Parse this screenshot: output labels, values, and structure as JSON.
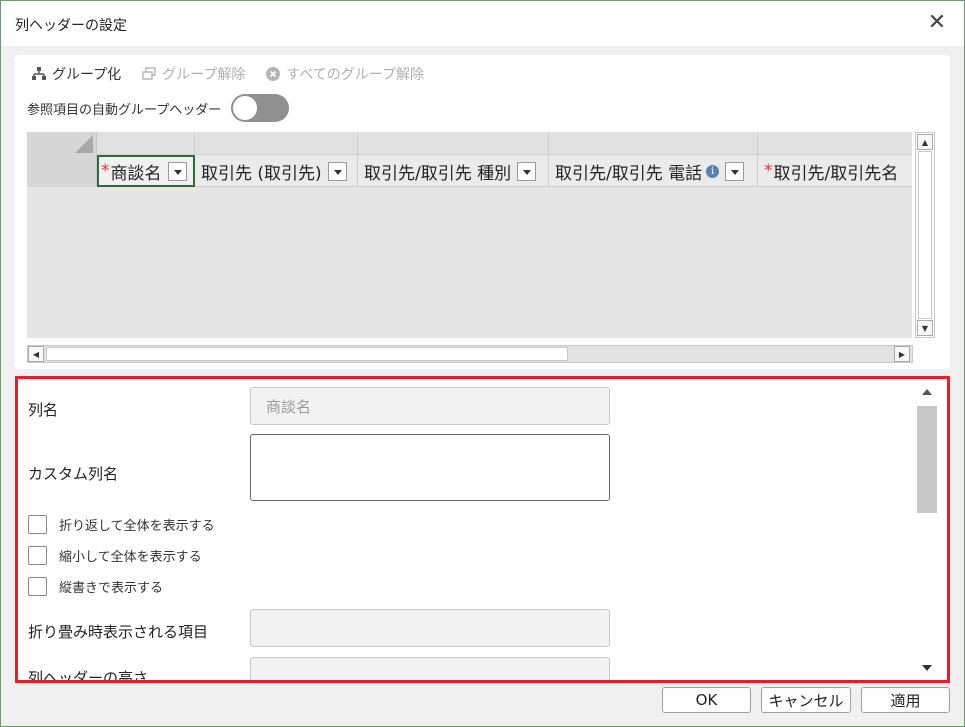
{
  "dialog": {
    "title": "列ヘッダーの設定",
    "close_glyph": "✕"
  },
  "toolbar": {
    "group": "グループ化",
    "ungroup": "グループ解除",
    "ungroup_all": "すべてのグループ解除"
  },
  "auto_group_toggle": {
    "label": "参照項目の自動グループヘッダー",
    "on": false
  },
  "grid": {
    "columns": [
      {
        "label": "商談名",
        "required": true,
        "selected": true
      },
      {
        "label": "取引先 (取引先)",
        "required": false
      },
      {
        "label": "取引先/取引先 種別",
        "required": false
      },
      {
        "label": "取引先/取引先 電話",
        "required": false,
        "info": "i"
      },
      {
        "label": "取引先/取引先名",
        "required": true
      }
    ],
    "required_mark": "*"
  },
  "properties": {
    "column_name": {
      "label": "列名",
      "placeholder": "商談名"
    },
    "custom_column_name": {
      "label": "カスタム列名",
      "value": ""
    },
    "checkboxes": [
      {
        "label": "折り返して全体を表示する",
        "checked": false
      },
      {
        "label": "縮小して全体を表示する",
        "checked": false
      },
      {
        "label": "縦書きで表示する",
        "checked": false
      }
    ],
    "collapsed_items": {
      "label": "折り畳み時表示される項目",
      "value": ""
    },
    "header_height": {
      "label": "列ヘッダーの高さ"
    }
  },
  "buttons": {
    "ok": "OK",
    "cancel": "キャンセル",
    "apply": "適用"
  },
  "colors": {
    "highlight_border": "#e0202a",
    "selected_column": "#2d6a3a",
    "required": "#e03030"
  }
}
